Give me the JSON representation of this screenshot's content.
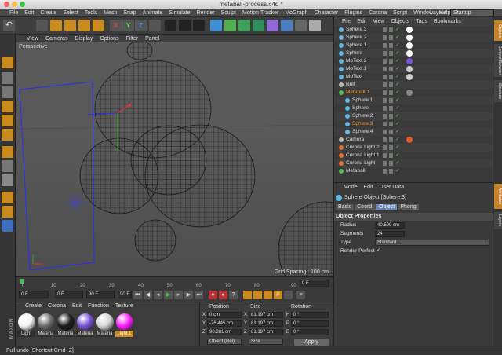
{
  "window": {
    "title": "metaball-process.c4d *"
  },
  "menu": [
    "File",
    "Edit",
    "Create",
    "Select",
    "Tools",
    "Mesh",
    "Snap",
    "Animate",
    "Simulate",
    "Render",
    "Sculpt",
    "Motion Tracker",
    "MoGraph",
    "Character",
    "Plugins",
    "Corona",
    "Script",
    "Window",
    "Help"
  ],
  "layout": {
    "label": "Layout:",
    "value": "Startup"
  },
  "viewport": {
    "menu": [
      "View",
      "Cameras",
      "Display",
      "Options",
      "Filter",
      "Panel"
    ],
    "name": "Perspective",
    "grid_spacing": "Grid Spacing : 100 cm"
  },
  "timeline": {
    "ticks": [
      "0",
      "10",
      "20",
      "30",
      "40",
      "50",
      "60",
      "70",
      "80",
      "90"
    ],
    "current_frame": "0 F"
  },
  "transport": {
    "start": "0 F",
    "current": "0 F",
    "preview_end": "90 F",
    "end": "90 F"
  },
  "materials": {
    "menu": [
      "Create",
      "Corona",
      "Edit",
      "Function",
      "Texture"
    ],
    "items": [
      {
        "label": "Light",
        "color": "#f4f4f4"
      },
      {
        "label": "Materia",
        "color": "#6c6c6c"
      },
      {
        "label": "Materia",
        "color": "#1e1e1e"
      },
      {
        "label": "Materia",
        "color": "#7a56d6"
      },
      {
        "label": "Materia",
        "color": "#d6d6d6"
      },
      {
        "label": "Light.1",
        "color": "#ff20ff"
      }
    ]
  },
  "coords": {
    "headers": {
      "position": "Position",
      "size": "Size",
      "rotation": "Rotation"
    },
    "rows": [
      {
        "axis": "X",
        "pos": "0 cm",
        "size_axis": "X",
        "size": "81.197 cm",
        "rot_axis": "H",
        "rot": "0 °"
      },
      {
        "axis": "Y",
        "pos": "-76.445 cm",
        "size_axis": "Y",
        "size": "81.197 cm",
        "rot_axis": "P",
        "rot": "0 °"
      },
      {
        "axis": "Z",
        "pos": "90.381 cm",
        "size_axis": "Z",
        "size": "81.197 cm",
        "rot_axis": "B",
        "rot": "0 °"
      }
    ],
    "mode": "Object (Rel)",
    "size_mode": "Size",
    "apply": "Apply"
  },
  "status": "Full undo [Shortcut Cmd+Z]",
  "objects": {
    "menu": [
      "File",
      "Edit",
      "View",
      "Objects",
      "Tags",
      "Bookmarks"
    ],
    "items": [
      {
        "name": "Sphere.3",
        "color": "#5fb6e6",
        "indent": 0,
        "highlight": false,
        "tag": "#ffffff"
      },
      {
        "name": "Sphere.2",
        "color": "#5fb6e6",
        "indent": 0,
        "highlight": false,
        "tag": "#ffffff"
      },
      {
        "name": "Sphere.1",
        "color": "#5fb6e6",
        "indent": 0,
        "highlight": false,
        "tag": "#ffffff"
      },
      {
        "name": "Sphere",
        "color": "#5fb6e6",
        "indent": 0,
        "highlight": false,
        "tag": "#ffffff"
      },
      {
        "name": "MoText.2",
        "color": "#5fb6e6",
        "indent": 0,
        "highlight": false,
        "tag": "#7a56d6"
      },
      {
        "name": "MoText.1",
        "color": "#5fb6e6",
        "indent": 0,
        "highlight": false,
        "tag": "#cccccc"
      },
      {
        "name": "MoText",
        "color": "#5fb6e6",
        "indent": 0,
        "highlight": false,
        "tag": "#cccccc"
      },
      {
        "name": "Null",
        "color": "#bbbbbb",
        "indent": 0,
        "highlight": false,
        "tag": ""
      },
      {
        "name": "Metaball.1",
        "color": "#4fc24f",
        "indent": 0,
        "highlight": true,
        "tag": "#888888"
      },
      {
        "name": "Sphere.1",
        "color": "#5fb6e6",
        "indent": 1,
        "highlight": false,
        "tag": ""
      },
      {
        "name": "Sphere",
        "color": "#5fb6e6",
        "indent": 1,
        "highlight": false,
        "tag": ""
      },
      {
        "name": "Sphere.2",
        "color": "#5fb6e6",
        "indent": 1,
        "highlight": false,
        "tag": ""
      },
      {
        "name": "Sphere.3",
        "color": "#5fb6e6",
        "indent": 1,
        "highlight": true,
        "tag": ""
      },
      {
        "name": "Sphere.4",
        "color": "#5fb6e6",
        "indent": 1,
        "highlight": false,
        "tag": ""
      },
      {
        "name": "Camera",
        "color": "#bbbbbb",
        "indent": 0,
        "highlight": false,
        "tag": "#e05a2a"
      },
      {
        "name": "Corona Light.2",
        "color": "#e0702a",
        "indent": 0,
        "highlight": false,
        "tag": ""
      },
      {
        "name": "Corona Light.1",
        "color": "#e0702a",
        "indent": 0,
        "highlight": false,
        "tag": ""
      },
      {
        "name": "Corona Light",
        "color": "#e0702a",
        "indent": 0,
        "highlight": false,
        "tag": ""
      },
      {
        "name": "Metaball",
        "color": "#4fc24f",
        "indent": 0,
        "highlight": false,
        "tag": ""
      }
    ]
  },
  "attributes": {
    "menu": [
      "Mode",
      "Edit",
      "User Data"
    ],
    "header": "Sphere Object [Sphere.3]",
    "tabs": [
      {
        "label": "Basic",
        "active": false
      },
      {
        "label": "Coord.",
        "active": false
      },
      {
        "label": "Object",
        "active": true
      },
      {
        "label": "Phong",
        "active": false
      }
    ],
    "section": "Object Properties",
    "props": [
      {
        "label": "Radius",
        "value": "40.599 cm"
      },
      {
        "label": "Segments",
        "value": "24"
      },
      {
        "label": "Type",
        "value": "Standard"
      },
      {
        "label": "Render Perfect",
        "value": "✓"
      }
    ]
  },
  "side_tabs": [
    "Objects",
    "Content Browser",
    "Structure",
    "Attributes",
    "Layers"
  ]
}
